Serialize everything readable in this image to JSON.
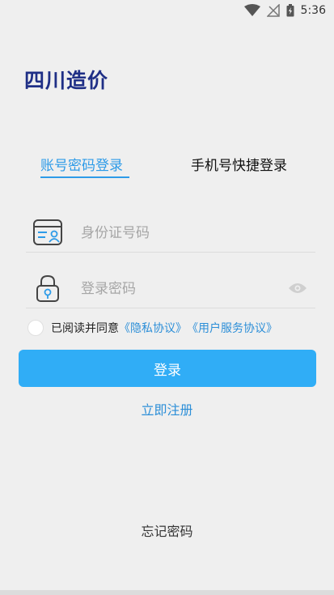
{
  "status_bar": {
    "time": "5:36",
    "icons": [
      "wifi-icon",
      "no-signal-icon",
      "battery-icon"
    ]
  },
  "app": {
    "title": "四川造价"
  },
  "tabs": [
    {
      "label": "账号密码登录",
      "active": true
    },
    {
      "label": "手机号快捷登录",
      "active": false
    }
  ],
  "form": {
    "id_placeholder": "身份证号码",
    "password_placeholder": "登录密码"
  },
  "agreement": {
    "prefix": "已阅读并同意",
    "privacy_link": "《隐私协议》",
    "service_link": "《用户服务协议》"
  },
  "buttons": {
    "login": "登录",
    "register": "立即注册",
    "forgot": "忘记密码"
  },
  "colors": {
    "accent": "#30adf6",
    "link": "#2d8fd8",
    "title": "#1f2f86",
    "background": "#efefef"
  }
}
